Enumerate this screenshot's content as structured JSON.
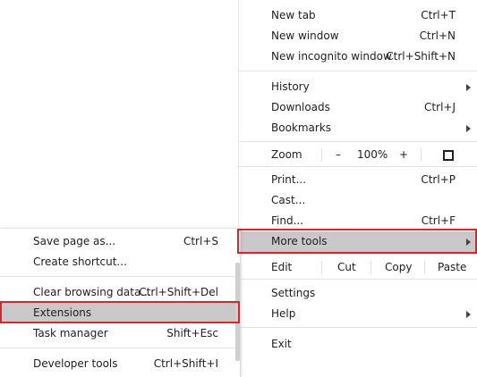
{
  "main_menu": {
    "new_tab": {
      "label": "New tab",
      "shortcut": "Ctrl+T"
    },
    "new_window": {
      "label": "New window",
      "shortcut": "Ctrl+N"
    },
    "new_incognito": {
      "label": "New incognito window",
      "shortcut": "Ctrl+Shift+N"
    },
    "history": {
      "label": "History"
    },
    "downloads": {
      "label": "Downloads",
      "shortcut": "Ctrl+J"
    },
    "bookmarks": {
      "label": "Bookmarks"
    },
    "zoom": {
      "label": "Zoom",
      "minus": "–",
      "level": "100%",
      "plus": "+"
    },
    "print": {
      "label": "Print...",
      "shortcut": "Ctrl+P"
    },
    "cast": {
      "label": "Cast..."
    },
    "find": {
      "label": "Find...",
      "shortcut": "Ctrl+F"
    },
    "more_tools": {
      "label": "More tools"
    },
    "edit": {
      "label": "Edit",
      "cut": "Cut",
      "copy": "Copy",
      "paste": "Paste"
    },
    "settings": {
      "label": "Settings"
    },
    "help": {
      "label": "Help"
    },
    "exit": {
      "label": "Exit"
    }
  },
  "sub_menu": {
    "save_page": {
      "label": "Save page as...",
      "shortcut": "Ctrl+S"
    },
    "create_shortcut": {
      "label": "Create shortcut..."
    },
    "clear_data": {
      "label": "Clear browsing data...",
      "shortcut": "Ctrl+Shift+Del"
    },
    "extensions": {
      "label": "Extensions"
    },
    "task_manager": {
      "label": "Task manager",
      "shortcut": "Shift+Esc"
    },
    "dev_tools": {
      "label": "Developer tools",
      "shortcut": "Ctrl+Shift+I"
    }
  },
  "colors": {
    "highlight": "#c9c9c9",
    "annotation_red": "#e0232a"
  },
  "icons": {
    "submenu_arrow": "chevron-right-icon",
    "fullscreen": "fullscreen-icon"
  }
}
